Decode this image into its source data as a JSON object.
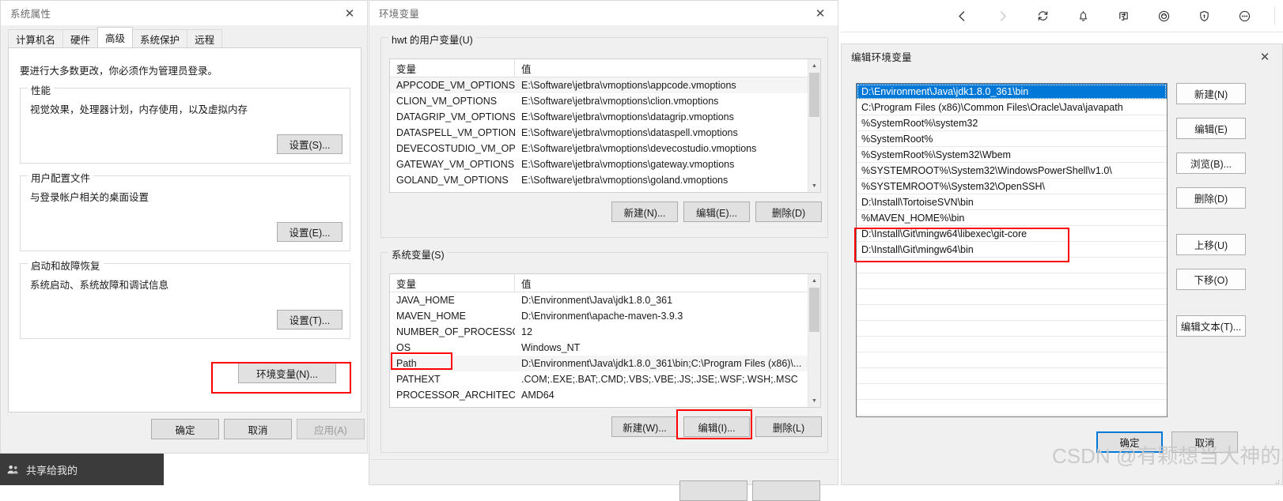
{
  "browser_toolbar": {
    "icons": [
      {
        "name": "back-icon",
        "glyph": "‹",
        "dim": false
      },
      {
        "name": "forward-icon",
        "glyph": "›",
        "dim": true
      },
      {
        "name": "refresh-icon",
        "glyph": "refresh",
        "dim": false
      },
      {
        "name": "notification-bell-icon",
        "glyph": "bell",
        "dim": false
      },
      {
        "name": "share-export-icon",
        "glyph": "export",
        "dim": false
      },
      {
        "name": "target-circle-icon",
        "glyph": "target",
        "dim": false
      },
      {
        "name": "shield-icon",
        "glyph": "shield",
        "dim": false
      },
      {
        "name": "more-options-icon",
        "glyph": "more",
        "dim": false
      }
    ]
  },
  "system_properties": {
    "title": "系统属性",
    "close_label": "✕",
    "tabs": [
      {
        "label": "计算机名",
        "active": false
      },
      {
        "label": "硬件",
        "active": false
      },
      {
        "label": "高级",
        "active": true
      },
      {
        "label": "系统保护",
        "active": false
      },
      {
        "label": "远程",
        "active": false
      }
    ],
    "notice": "要进行大多数更改，你必须作为管理员登录。",
    "groups": [
      {
        "label": "性能",
        "desc": "视觉效果，处理器计划，内存使用，以及虚拟内存",
        "button": "设置(S)..."
      },
      {
        "label": "用户配置文件",
        "desc": "与登录帐户相关的桌面设置",
        "button": "设置(E)..."
      },
      {
        "label": "启动和故障恢复",
        "desc": "系统启动、系统故障和调试信息",
        "button": "设置(T)..."
      }
    ],
    "env_button": "环境变量(N)...",
    "footer_buttons": [
      {
        "label": "确定",
        "disabled": false
      },
      {
        "label": "取消",
        "disabled": false
      },
      {
        "label": "应用(A)",
        "disabled": true
      }
    ]
  },
  "environment_variables": {
    "title": "环境变量",
    "close_label": "✕",
    "user_group_label": "hwt 的用户变量(U)",
    "columns": [
      "变量",
      "值"
    ],
    "user_vars": [
      {
        "name": "APPCODE_VM_OPTIONS",
        "value": "E:\\Software\\jetbra\\vmoptions\\appcode.vmoptions"
      },
      {
        "name": "CLION_VM_OPTIONS",
        "value": "E:\\Software\\jetbra\\vmoptions\\clion.vmoptions"
      },
      {
        "name": "DATAGRIP_VM_OPTIONS",
        "value": "E:\\Software\\jetbra\\vmoptions\\datagrip.vmoptions"
      },
      {
        "name": "DATASPELL_VM_OPTIONS",
        "value": "E:\\Software\\jetbra\\vmoptions\\dataspell.vmoptions"
      },
      {
        "name": "DEVECOSTUDIO_VM_OPT...",
        "value": "E:\\Software\\jetbra\\vmoptions\\devecostudio.vmoptions"
      },
      {
        "name": "GATEWAY_VM_OPTIONS",
        "value": "E:\\Software\\jetbra\\vmoptions\\gateway.vmoptions"
      },
      {
        "name": "GOLAND_VM_OPTIONS",
        "value": "E:\\Software\\jetbra\\vmoptions\\goland.vmoptions"
      }
    ],
    "user_buttons": [
      {
        "label": "新建(N)..."
      },
      {
        "label": "编辑(E)..."
      },
      {
        "label": "删除(D)"
      }
    ],
    "system_group_label": "系统变量(S)",
    "system_vars": [
      {
        "name": "JAVA_HOME",
        "value": "D:\\Environment\\Java\\jdk1.8.0_361"
      },
      {
        "name": "MAVEN_HOME",
        "value": "D:\\Environment\\apache-maven-3.9.3"
      },
      {
        "name": "NUMBER_OF_PROCESSORS",
        "value": "12"
      },
      {
        "name": "OS",
        "value": "Windows_NT"
      },
      {
        "name": "Path",
        "value": "D:\\Environment\\Java\\jdk1.8.0_361\\bin;C:\\Program Files (x86)\\..."
      },
      {
        "name": "PATHEXT",
        "value": ".COM;.EXE;.BAT;.CMD;.VBS;.VBE;.JS;.JSE;.WSF;.WSH;.MSC"
      },
      {
        "name": "PROCESSOR_ARCHITECT...",
        "value": "AMD64"
      }
    ],
    "system_buttons": [
      {
        "label": "新建(W)..."
      },
      {
        "label": "编辑(I)..."
      },
      {
        "label": "删除(L)"
      }
    ]
  },
  "edit_environment_variable": {
    "title": "编辑环境变量",
    "close_label": "✕",
    "paths": [
      {
        "value": "D:\\Environment\\Java\\jdk1.8.0_361\\bin",
        "selected": true
      },
      {
        "value": "C:\\Program Files (x86)\\Common Files\\Oracle\\Java\\javapath",
        "selected": false
      },
      {
        "value": "%SystemRoot%\\system32",
        "selected": false
      },
      {
        "value": "%SystemRoot%",
        "selected": false
      },
      {
        "value": "%SystemRoot%\\System32\\Wbem",
        "selected": false
      },
      {
        "value": "%SYSTEMROOT%\\System32\\WindowsPowerShell\\v1.0\\",
        "selected": false
      },
      {
        "value": "%SYSTEMROOT%\\System32\\OpenSSH\\",
        "selected": false
      },
      {
        "value": "D:\\Install\\TortoiseSVN\\bin",
        "selected": false
      },
      {
        "value": "%MAVEN_HOME%\\bin",
        "selected": false
      },
      {
        "value": "D:\\Install\\Git\\mingw64\\libexec\\git-core",
        "selected": false
      },
      {
        "value": "D:\\Install\\Git\\mingw64\\bin",
        "selected": false
      }
    ],
    "side_buttons": [
      {
        "label": "新建(N)"
      },
      {
        "label": "编辑(E)"
      },
      {
        "label": "浏览(B)..."
      },
      {
        "label": "删除(D)"
      },
      {
        "label": "上移(U)"
      },
      {
        "label": "下移(O)"
      },
      {
        "label": "编辑文本(T)..."
      }
    ],
    "footer_buttons": [
      {
        "label": "确定",
        "default": true
      },
      {
        "label": "取消",
        "default": false
      }
    ]
  },
  "taskbar": {
    "item_label": "共享给我的",
    "icon": "people-shared-icon"
  },
  "watermark": {
    "text": "CSDN @有颗想当大神的心"
  },
  "colors": {
    "accent": "#0078d7",
    "annotation": "#ff0000",
    "dialog_bg": "#f0f0f0",
    "list_bg": "#ffffff"
  }
}
